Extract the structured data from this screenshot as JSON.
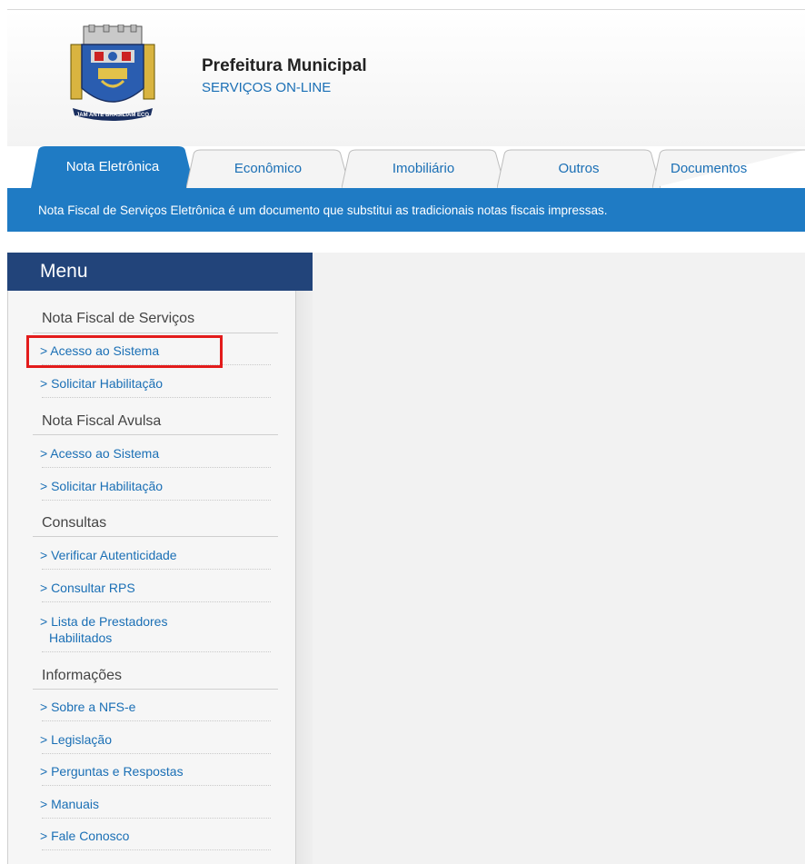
{
  "header": {
    "title": "Prefeitura Municipal",
    "subtitle": "SERVIÇOS ON-LINE",
    "logo_motto": "JAM ANTE BRASILIAM ECO"
  },
  "tabs": [
    {
      "label": "Nota Eletrônica",
      "active": true
    },
    {
      "label": "Econômico",
      "active": false
    },
    {
      "label": "Imobiliário",
      "active": false
    },
    {
      "label": "Outros",
      "active": false
    },
    {
      "label": "Documentos",
      "active": false
    }
  ],
  "infobar": {
    "text": "Nota Fiscal de Serviços Eletrônica é um documento que substitui as tradicionais notas fiscais impressas."
  },
  "menu": {
    "title": "Menu",
    "sections": [
      {
        "title": "Nota Fiscal de Serviços",
        "links": [
          "> Acesso ao Sistema",
          "> Solicitar Habilitação"
        ]
      },
      {
        "title": "Nota Fiscal Avulsa",
        "links": [
          "> Acesso ao Sistema",
          "> Solicitar Habilitação"
        ]
      },
      {
        "title": "Consultas",
        "links": [
          "> Verificar Autenticidade",
          "> Consultar RPS",
          "> Lista de Prestadores",
          "Habilitados"
        ]
      },
      {
        "title": "Informações",
        "links": [
          "> Sobre a NFS-e",
          "> Legislação",
          "> Perguntas e Respostas",
          "> Manuais",
          "> Fale Conosco"
        ]
      }
    ]
  },
  "colors": {
    "brand_blue": "#1f7bc4",
    "menu_navy": "#22447a",
    "link_blue": "#1a6fb5",
    "highlight_red": "#e31b1b"
  }
}
